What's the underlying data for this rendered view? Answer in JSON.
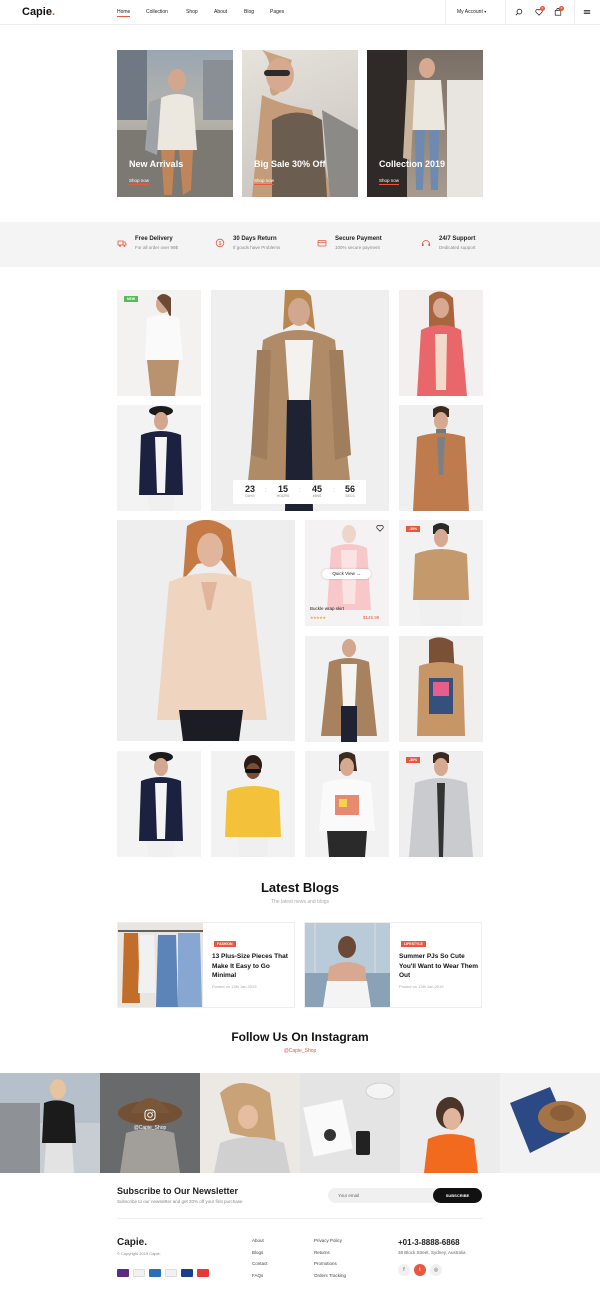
{
  "brand": {
    "name": "Capie",
    "dot": ".",
    "accent": "#e9573f"
  },
  "nav": {
    "items": [
      "Home",
      "Collection",
      "Shop",
      "About",
      "Blog",
      "Pages"
    ],
    "my_account": "My Account",
    "wishlist_count": "0",
    "cart_count": "0"
  },
  "hero": [
    {
      "title": "New Arrivals",
      "link": "Shop now"
    },
    {
      "title": "Big Sale 30% Off",
      "link": "Shop now"
    },
    {
      "title": "Collection 2019",
      "link": "Shop now"
    }
  ],
  "features": [
    {
      "title": "Free Delivery",
      "sub": "For all order over 99$",
      "icon": "truck-icon"
    },
    {
      "title": "30 Days Return",
      "sub": "If goods have Problems",
      "icon": "return-coin-icon"
    },
    {
      "title": "Secure Payment",
      "sub": "100% secure payment",
      "icon": "credit-card-icon"
    },
    {
      "title": "24/7 Support",
      "sub": "Dedicated support",
      "icon": "support-icon"
    }
  ],
  "products": {
    "new_tag": "NEW",
    "sale_tag": "-30%",
    "countdown": [
      {
        "num": "23",
        "label": "DAYS"
      },
      {
        "num": "15",
        "label": "HOURS"
      },
      {
        "num": "45",
        "label": "MINS"
      },
      {
        "num": "56",
        "label": "SECS"
      }
    ],
    "quick_view": "Quick View",
    "featured_name": "Buckle wrap skirt",
    "featured_price": "$145.99",
    "featured_rating": 5
  },
  "blogs": {
    "title": "Latest Blogs",
    "subtitle": "The latest news and blogs",
    "items": [
      {
        "tag": "FASHION",
        "title": "13 Plus-Size Pieces That Make It Easy to Go Minimal",
        "date": "Posted on 13th Jan,2019"
      },
      {
        "tag": "LIFESTYLE",
        "title": "Summer PJs So Cute You'll Want to Wear Them Out",
        "date": "Posted on 13th Jan,2019"
      }
    ]
  },
  "instagram": {
    "title": "Follow Us On Instagram",
    "handle": "@Capie_Shop",
    "overlay_handle": "@Capie_Shop"
  },
  "newsletter": {
    "title": "Subscribe to Our Newsletter",
    "sub": "Subscribe to our newsletter and get 20% off your first purchase",
    "placeholder": "Your email",
    "button": "SUBSCRIBE"
  },
  "footer": {
    "logo": "Capie.",
    "copyright": "© Copyright 2019 Capie.",
    "col1": [
      "About",
      "Blogs",
      "Contact",
      "FAQs"
    ],
    "col2": [
      "Privacy Policy",
      "Returns",
      "Promotions",
      "Orders Tracking"
    ],
    "phone": "+01-3-8888-6868",
    "address": "38 Block Street, Sydney, Australia",
    "payments": [
      "Skrill",
      "Discover",
      "Amex",
      "PayPal",
      "Visa"
    ]
  }
}
